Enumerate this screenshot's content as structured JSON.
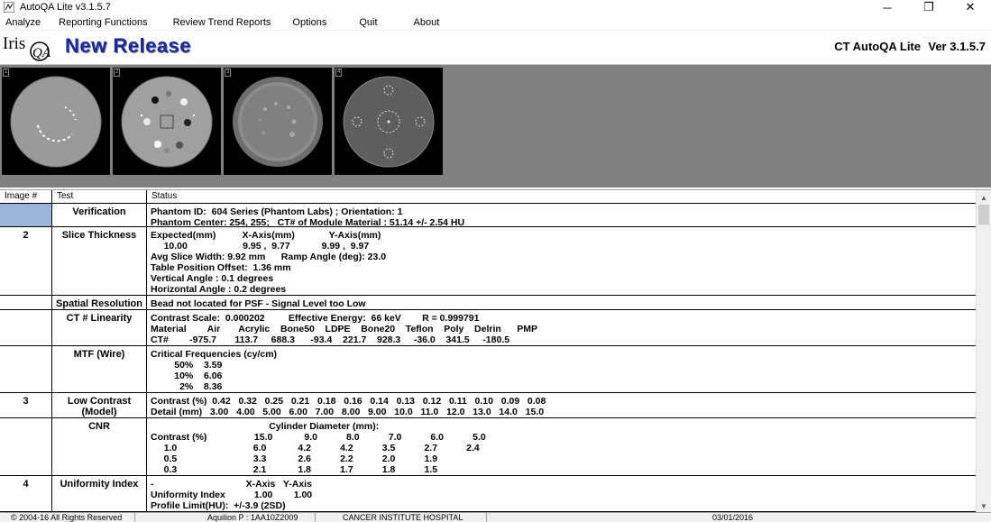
{
  "window": {
    "title": "AutoQA  Lite  v3.1.5.7",
    "minimize_glyph": "─",
    "restore_glyph": "❐",
    "close_glyph": "✕"
  },
  "menu": [
    "Analyze",
    "Reporting Functions",
    "Review Trend Reports",
    "Options",
    "Quit",
    "About"
  ],
  "header": {
    "logo_text_iris": "Iris",
    "logo_text_qa": "QA",
    "release_title": "New Release",
    "product_name": "CT AutoQA Lite",
    "product_version": "Ver 3.1.5.7"
  },
  "thumbnails": [
    "1",
    "2",
    "3",
    "4"
  ],
  "table": {
    "headers": [
      "Image #",
      "Test",
      "Status"
    ],
    "rows": [
      {
        "image": "",
        "test": "Verification",
        "status": [
          "Phantom ID:  604 Series (Phantom Labs) ; Orientation: 1",
          "Phantom Center: 254, 255;   CT# of Module Material : 51.14 +/- 2.54 HU"
        ]
      },
      {
        "image": "2",
        "test": "Slice Thickness",
        "status": [
          "Expected(mm)          X-Axis(mm)             Y-Axis(mm)",
          "     10.00                     9.95 ,  9.77            9.99 ,  9.97",
          "Avg Slice Width: 9.92 mm      Ramp Angle (deg): 23.0",
          "Table Position Offset:  1.36 mm",
          "Vertical Angle : 0.1 degrees",
          "Horizontal Angle : 0.2 degrees"
        ]
      },
      {
        "image": "",
        "test": "Spatial Resolution",
        "status": [
          "Bead not located for PSF - Signal Level too Low"
        ]
      },
      {
        "image": "",
        "test": "CT # Linearity",
        "status": [
          "Contrast Scale:  0.000202         Effective Energy:  66 keV        R = 0.999791",
          "Material        Air       Acrylic    Bone50    LDPE    Bone20    Teflon    Poly    Delrin      PMP",
          "CT#        -975.7       113.7     688.3      -93.4    221.7    928.3     -36.0    341.5     -180.5"
        ]
      },
      {
        "image": "",
        "test": "MTF (Wire)",
        "status": [
          "Critical Frequencies (cy/cm)",
          "         50%    3.59",
          "         10%    6.06",
          "           2%    8.36"
        ]
      },
      {
        "image": "3",
        "test": "Low Contrast (Model)",
        "status": [
          "Contrast (%)  0.42   0.32   0.25   0.21   0.18   0.16   0.14   0.13   0.12   0.11   0.10   0.09   0.08",
          "Detail (mm)   3.00   4.00   5.00   6.00   7.00   8.00   9.00   10.0   11.0   12.0   13.0   14.0   15.0"
        ]
      },
      {
        "image": "",
        "test": "CNR",
        "status": [
          "                                             Cylinder Diameter (mm):",
          "Contrast (%)                  15.0            9.0           8.0           7.0           6.0           5.0",
          "     1.0                             6.0            4.2           4.2           3.5           2.7           2.4",
          "     0.5                             3.3            2.6           2.2           2.0           1.9",
          "     0.3                             2.1            1.8           1.7           1.8           1.5"
        ]
      },
      {
        "image": "4",
        "test": "Uniformity Index",
        "status": [
          "-                                   X-Axis   Y-Axis",
          "Uniformity Index           1.00        1.00",
          "Profile Limit(HU):  +/-3.9 (2SD)"
        ]
      }
    ]
  },
  "statusbar": [
    "© 2004-16    All Rights Reserved",
    "Aquilion P  :  1AA10Z2009",
    "CANCER INSTITUTE HOSPITAL",
    "03/01/2016"
  ]
}
